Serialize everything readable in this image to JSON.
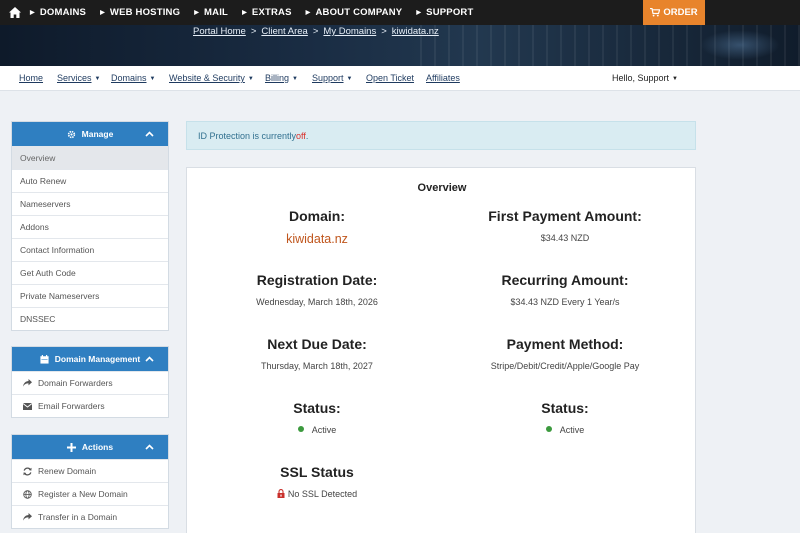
{
  "topnav": {
    "items": [
      "DOMAINS",
      "WEB HOSTING",
      "MAIL",
      "EXTRAS",
      "ABOUT COMPANY",
      "SUPPORT"
    ],
    "order_label": "ORDER"
  },
  "breadcrumb": [
    "Portal Home",
    "Client Area",
    "My Domains",
    "kiwidata.nz"
  ],
  "breadcrumb_sep": ">",
  "subnav": {
    "items": [
      "Home",
      "Services",
      "Domains",
      "Website & Security",
      "Billing",
      "Support",
      "Open Ticket",
      "Affiliates"
    ],
    "greeting": "Hello, Support"
  },
  "sidebar": {
    "manage": {
      "title": "Manage",
      "items": [
        "Overview",
        "Auto Renew",
        "Nameservers",
        "Addons",
        "Contact Information",
        "Get Auth Code",
        "Private Nameservers",
        "DNSSEC"
      ]
    },
    "domain_management": {
      "title": "Domain Management",
      "items": [
        "Domain Forwarders",
        "Email Forwarders"
      ]
    },
    "actions": {
      "title": "Actions",
      "items": [
        "Renew Domain",
        "Register a New Domain",
        "Transfer in a Domain"
      ]
    }
  },
  "alert": {
    "text": "ID Protection is currently ",
    "status": "off",
    "suffix": "."
  },
  "overview": {
    "title": "Overview",
    "domain_label": "Domain:",
    "domain_value": "kiwidata.nz",
    "first_payment_label": "First Payment Amount:",
    "first_payment_value": "$34.43 NZD",
    "registration_label": "Registration Date:",
    "registration_value": "Wednesday, March 18th, 2026",
    "recurring_label": "Recurring Amount:",
    "recurring_value": "$34.43 NZD Every 1 Year/s",
    "next_due_label": "Next Due Date:",
    "next_due_value": "Thursday, March 18th, 2027",
    "payment_method_label": "Payment Method:",
    "payment_method_value": "Stripe/Debit/Credit/Apple/Google Pay",
    "status_label": "Status:",
    "status_value": "Active",
    "status2_label": "Status:",
    "status2_value": "Active",
    "ssl_label": "SSL Status",
    "ssl_value": "No SSL Detected"
  },
  "colors": {
    "accent": "#2f7fc1",
    "order": "#e8842c",
    "domain_text": "#c0561d",
    "active_dot": "#3c9a3e",
    "alert_off": "#d9302b"
  }
}
